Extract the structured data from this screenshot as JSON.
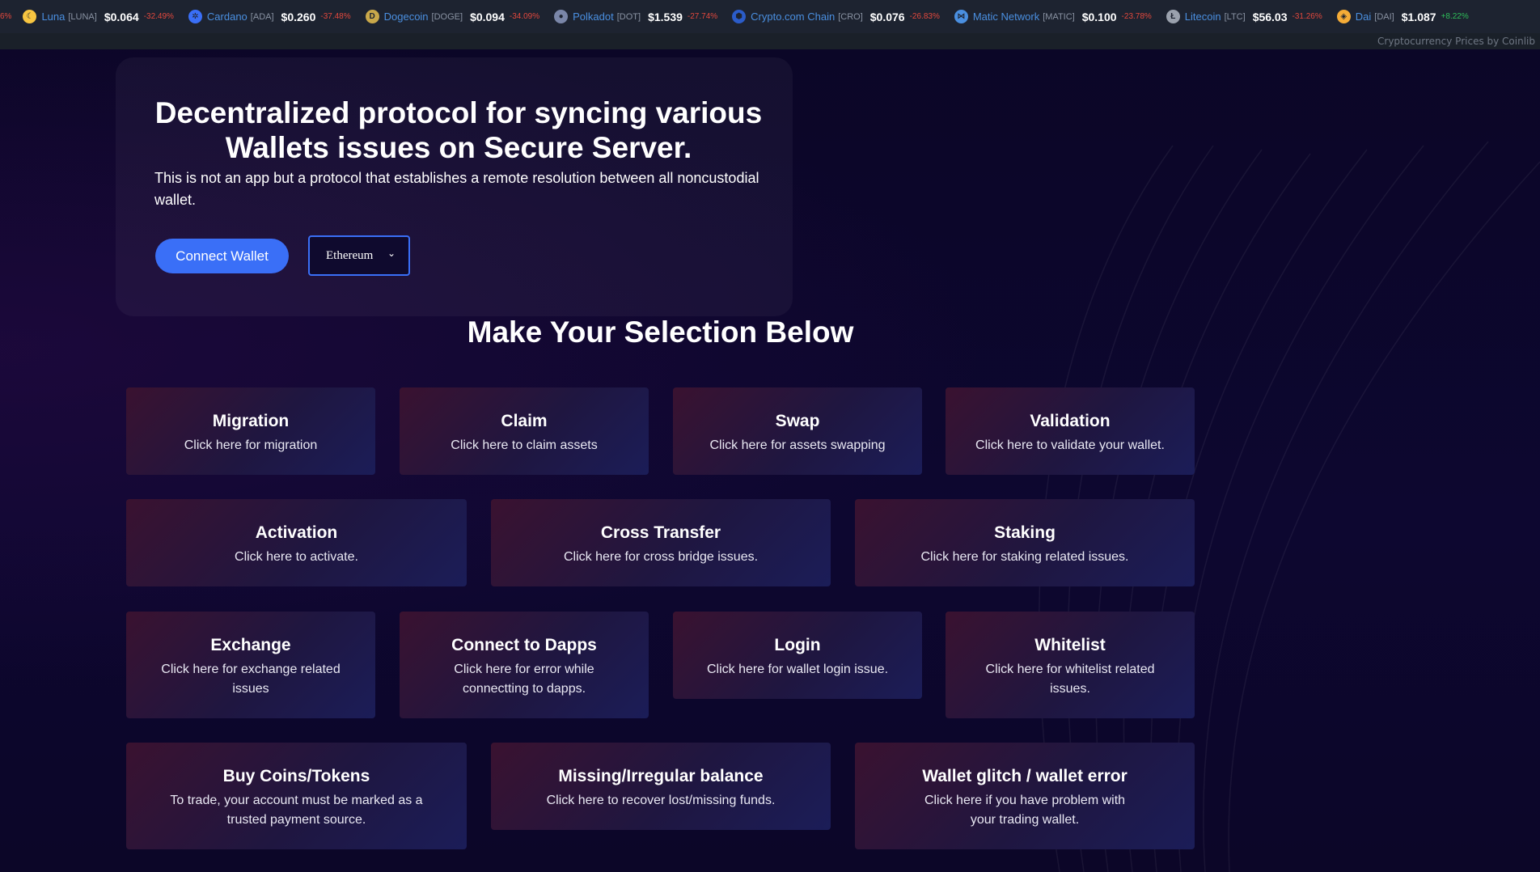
{
  "ticker": {
    "lead_change": "6%",
    "items": [
      {
        "icon": "luna-icon",
        "glyph": "☾",
        "color": "#f7c541",
        "name": "Luna",
        "symbol": "[LUNA]",
        "price": "$0.064",
        "change": "-32.49%",
        "dir": "neg"
      },
      {
        "icon": "cardano-icon",
        "glyph": "✲",
        "color": "#3a6ff7",
        "name": "Cardano",
        "symbol": "[ADA]",
        "price": "$0.260",
        "change": "-37.48%",
        "dir": "neg"
      },
      {
        "icon": "dogecoin-icon",
        "glyph": "D",
        "color": "#c9a84a",
        "name": "Dogecoin",
        "symbol": "[DOGE]",
        "price": "$0.094",
        "change": "-34.09%",
        "dir": "neg"
      },
      {
        "icon": "polkadot-icon",
        "glyph": "●",
        "color": "#7a86a8",
        "name": "Polkadot",
        "symbol": "[DOT]",
        "price": "$1.539",
        "change": "-27.74%",
        "dir": "neg"
      },
      {
        "icon": "cronos-icon",
        "glyph": "⬢",
        "color": "#2b5cc9",
        "name": "Crypto.com Chain",
        "symbol": "[CRO]",
        "price": "$0.076",
        "change": "-26.83%",
        "dir": "neg"
      },
      {
        "icon": "polygon-icon",
        "glyph": "⋈",
        "color": "#4a8fe0",
        "name": "Matic Network",
        "symbol": "[MATIC]",
        "price": "$0.100",
        "change": "-23.78%",
        "dir": "neg"
      },
      {
        "icon": "litecoin-icon",
        "glyph": "Ł",
        "color": "#9aa1ad",
        "name": "Litecoin",
        "symbol": "[LTC]",
        "price": "$56.03",
        "change": "-31.26%",
        "dir": "neg"
      },
      {
        "icon": "dai-icon",
        "glyph": "◈",
        "color": "#f5ac37",
        "name": "Dai",
        "symbol": "[DAI]",
        "price": "$1.087",
        "change": "+8.22%",
        "dir": "pos"
      }
    ],
    "credit": "Cryptocurrency Prices by Coinlib"
  },
  "hero": {
    "title": "Decentralized protocol for syncing various Wallets issues on Secure Server.",
    "subtitle": "This is not an app but a protocol that establishes a remote resolution between all noncustodial wallet.",
    "connect_label": "Connect Wallet",
    "chain_selected": "Ethereum"
  },
  "section_title": "Make Your Selection Below",
  "cards": [
    {
      "title": "Migration",
      "desc": "Click here for migration"
    },
    {
      "title": "Claim",
      "desc": "Click here to claim assets"
    },
    {
      "title": "Swap",
      "desc": "Click here for assets swapping"
    },
    {
      "title": "Validation",
      "desc": "Click here to validate your wallet."
    },
    {
      "title": "Activation",
      "desc": "Click here to activate."
    },
    {
      "title": "Cross Transfer",
      "desc": "Click here for cross bridge issues."
    },
    {
      "title": "Staking",
      "desc": "Click here for staking related issues."
    },
    {
      "title": "Exchange",
      "desc": "Click here for exchange related issues"
    },
    {
      "title": "Connect to Dapps",
      "desc": "Click here for error while connectting to dapps."
    },
    {
      "title": "Login",
      "desc": "Click here for wallet login issue."
    },
    {
      "title": "Whitelist",
      "desc": "Click here for whitelist related issues."
    },
    {
      "title": "Buy Coins/Tokens",
      "desc": "To trade, your account must be marked as a trusted payment source."
    },
    {
      "title": "Missing/Irregular balance",
      "desc": "Click here to recover lost/missing funds."
    },
    {
      "title": "Wallet glitch / wallet error",
      "desc": "Click here if you have problem with your trading wallet."
    }
  ]
}
